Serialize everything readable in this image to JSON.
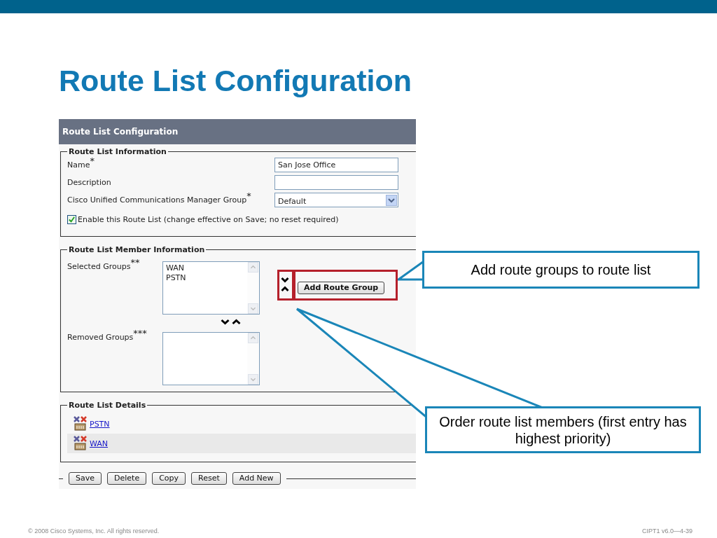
{
  "slide": {
    "title": "Route List Configuration",
    "footer_left": "© 2008 Cisco Systems, Inc. All rights reserved.",
    "footer_right": "CIPT1 v6.0—4-39"
  },
  "panel": {
    "title": "Route List Configuration",
    "info": {
      "legend": "Route List Information",
      "fields": [
        {
          "kind": "text",
          "label": "Name$^{*}$",
          "value": "San Jose Office"
        },
        {
          "kind": "text",
          "label": "Description"
        },
        {
          "kind": "select",
          "label": "Cisco Unified Communications Manager Group$^{*}$",
          "value": "Default"
        }
      ],
      "checkbox": {
        "label": "Enable this Route List (change effective on Save; no reset required)",
        "checked": true
      }
    },
    "members": {
      "legend": "Route List Member Information",
      "selected_label": "Selected Groups$^{**}$",
      "selected_items": [
        "WAN",
        "PSTN"
      ],
      "removed_label": "Removed Groups$^{***}$",
      "add_button": "Add Route Group"
    },
    "details": {
      "legend": "Route List Details",
      "rows": [
        {
          "link": "PSTN"
        },
        {
          "link": "WAN"
        }
      ]
    },
    "buttons": [
      "Save",
      "Delete",
      "Copy",
      "Reset",
      "Add New"
    ]
  },
  "callouts": [
    {
      "text": "Add route groups to route list"
    },
    {
      "text": "Order route list members (first entry has highest priority)"
    }
  ]
}
